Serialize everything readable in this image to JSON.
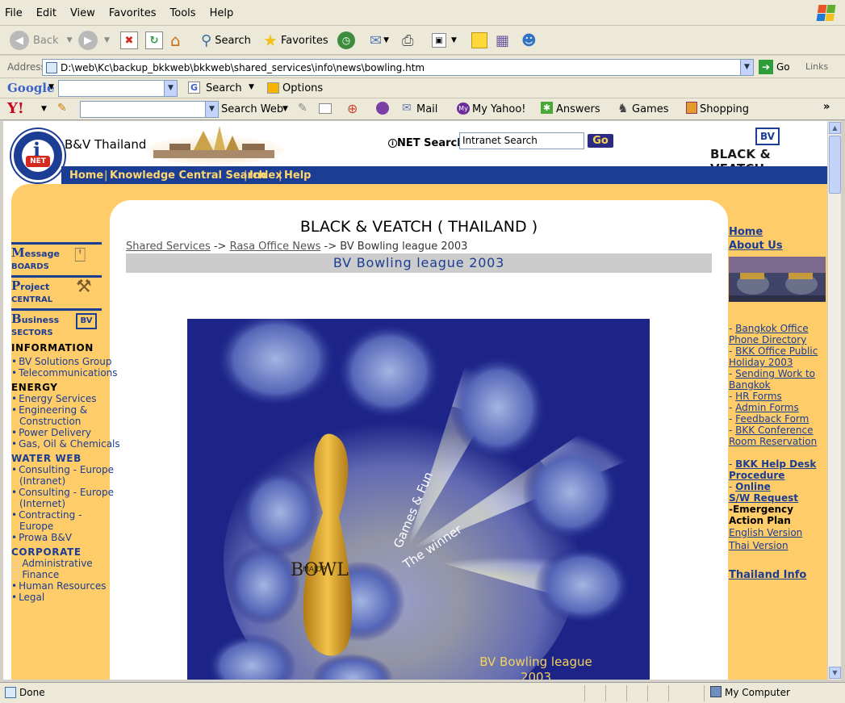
{
  "menu": [
    "File",
    "Edit",
    "View",
    "Favorites",
    "Tools",
    "Help"
  ],
  "toolbar": {
    "back": "Back",
    "search": "Search",
    "favorites": "Favorites"
  },
  "address": {
    "label": "Address",
    "url": "D:\\web\\Kc\\backup_bkkweb\\bkkweb\\shared_services\\info\\news\\bowling.htm",
    "go": "Go",
    "links": "Links"
  },
  "google": {
    "brand": "Google",
    "search": "Search",
    "options": "Options"
  },
  "yahoo": {
    "search_web": "Search Web",
    "mail": "Mail",
    "my_yahoo": "My Yahoo!",
    "answers": "Answers",
    "games": "Games",
    "shopping": "Shopping"
  },
  "header": {
    "site_name": "B&V Thailand",
    "search_label": "NET Search",
    "search_value": "Intranet Search",
    "search_go": "Go",
    "company": "BLACK & VEATCH",
    "company_badge": "BV",
    "nav": [
      "Home",
      "Knowledge Central Search",
      "Index",
      "Help"
    ]
  },
  "left_nav": {
    "badges": [
      {
        "big": "M",
        "rest": "essage",
        "small": "BOARDS"
      },
      {
        "big": "P",
        "rest": "roject",
        "small": "CENTRAL"
      },
      {
        "big": "B",
        "rest": "usiness",
        "small": "SECTORS"
      }
    ],
    "sections": [
      {
        "title": "INFORMATION",
        "items": [
          "BV Solutions Group",
          "Telecommunications"
        ]
      },
      {
        "title": "ENERGY",
        "items": [
          "Energy Services",
          "Engineering &",
          "Construction",
          "Power Delivery",
          "Gas, Oil & Chemicals"
        ]
      },
      {
        "title": "WATER WEB",
        "items": [
          "Consulting - Europe",
          "(Intranet)",
          "Consulting - Europe",
          "(Internet)",
          "Contracting -",
          "Europe",
          "Prowa B&V"
        ]
      },
      {
        "title": "CORPORATE",
        "items": [
          "Administrative",
          "Finance",
          "Human Resources",
          "Legal"
        ]
      }
    ]
  },
  "main": {
    "title": "BLACK & VEATCH ( THAILAND )",
    "crumb1": "Shared Services",
    "crumb2": "Rasa Office News",
    "crumb3": "BV Bowling league 2003",
    "arrow": "->",
    "banner": "BV Bowling league 2003",
    "poster": {
      "games_fun": "Games & Fun",
      "winner": "The winner",
      "bowl": "BOWL",
      "major": "MAJOR",
      "caption1": "BV Bowling league",
      "caption2": "2003"
    }
  },
  "right": {
    "home": "Home",
    "about": "About Us",
    "links": [
      "Bangkok Office",
      "Phone Directory",
      "BKK Office Public",
      "Holiday 2003",
      "Sending Work to",
      "Bangkok",
      "HR Forms",
      "Admin Forms",
      "Feedback Form",
      "BKK Conference",
      "Room Reservation"
    ],
    "help_desk": "BKK Help Desk",
    "procedure": "Procedure",
    "online": "Online",
    "sw_request": "S/W Request",
    "emergency": "-Emergency",
    "action_plan": "Action Plan",
    "english": "English Version",
    "thai": "Thai Version",
    "thailand_info": "Thailand Info"
  },
  "status": {
    "done": "Done",
    "zone": "My Computer"
  }
}
